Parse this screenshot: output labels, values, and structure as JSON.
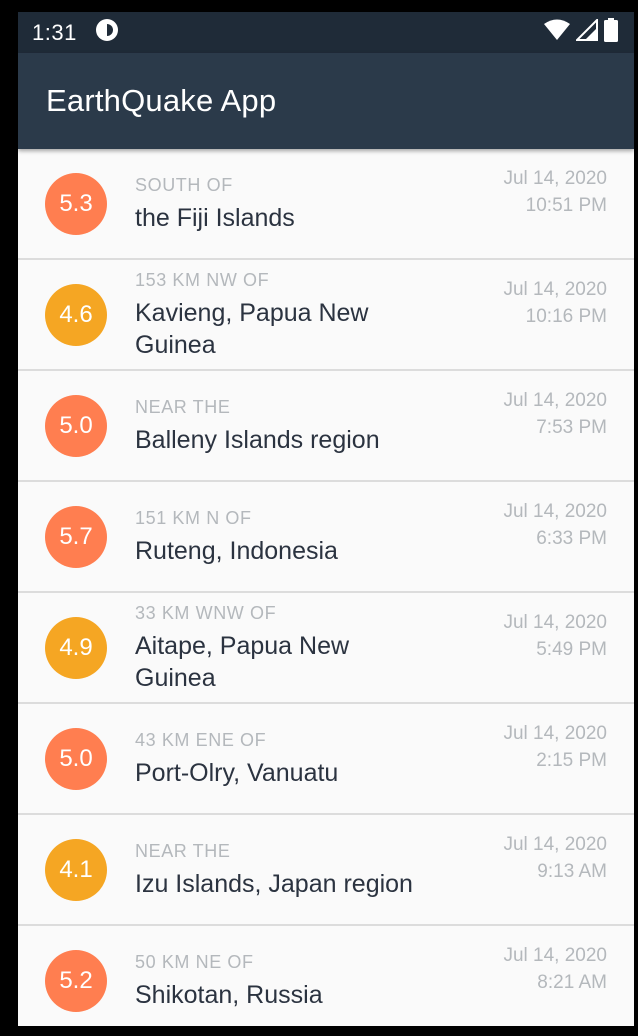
{
  "status_bar": {
    "time": "1:31"
  },
  "app_bar": {
    "title": "EarthQuake App"
  },
  "colors": {
    "orange": "#ff7e50",
    "yellow": "#f5a623",
    "appbar": "#2b3a4a",
    "statusbar": "#1f2b38"
  },
  "quakes": [
    {
      "mag": "5.3",
      "color": "#ff7e50",
      "offset": "SOUTH OF",
      "primary": "the Fiji Islands",
      "date": "Jul 14, 2020",
      "time": "10:51 PM"
    },
    {
      "mag": "4.6",
      "color": "#f5a623",
      "offset": "153 KM NW OF",
      "primary": "Kavieng, Papua New Guinea",
      "date": "Jul 14, 2020",
      "time": "10:16 PM"
    },
    {
      "mag": "5.0",
      "color": "#ff7e50",
      "offset": "NEAR THE",
      "primary": "Balleny Islands region",
      "date": "Jul 14, 2020",
      "time": "7:53 PM"
    },
    {
      "mag": "5.7",
      "color": "#ff7e50",
      "offset": "151 KM N OF",
      "primary": "Ruteng, Indonesia",
      "date": "Jul 14, 2020",
      "time": "6:33 PM"
    },
    {
      "mag": "4.9",
      "color": "#f5a623",
      "offset": "33 KM WNW OF",
      "primary": "Aitape, Papua New Guinea",
      "date": "Jul 14, 2020",
      "time": "5:49 PM"
    },
    {
      "mag": "5.0",
      "color": "#ff7e50",
      "offset": "43 KM ENE OF",
      "primary": "Port-Olry, Vanuatu",
      "date": "Jul 14, 2020",
      "time": "2:15 PM"
    },
    {
      "mag": "4.1",
      "color": "#f5a623",
      "offset": "NEAR THE",
      "primary": "Izu Islands, Japan region",
      "date": "Jul 14, 2020",
      "time": "9:13 AM"
    },
    {
      "mag": "5.2",
      "color": "#ff7e50",
      "offset": "50 KM NE OF",
      "primary": "Shikotan, Russia",
      "date": "Jul 14, 2020",
      "time": "8:21 AM"
    }
  ]
}
